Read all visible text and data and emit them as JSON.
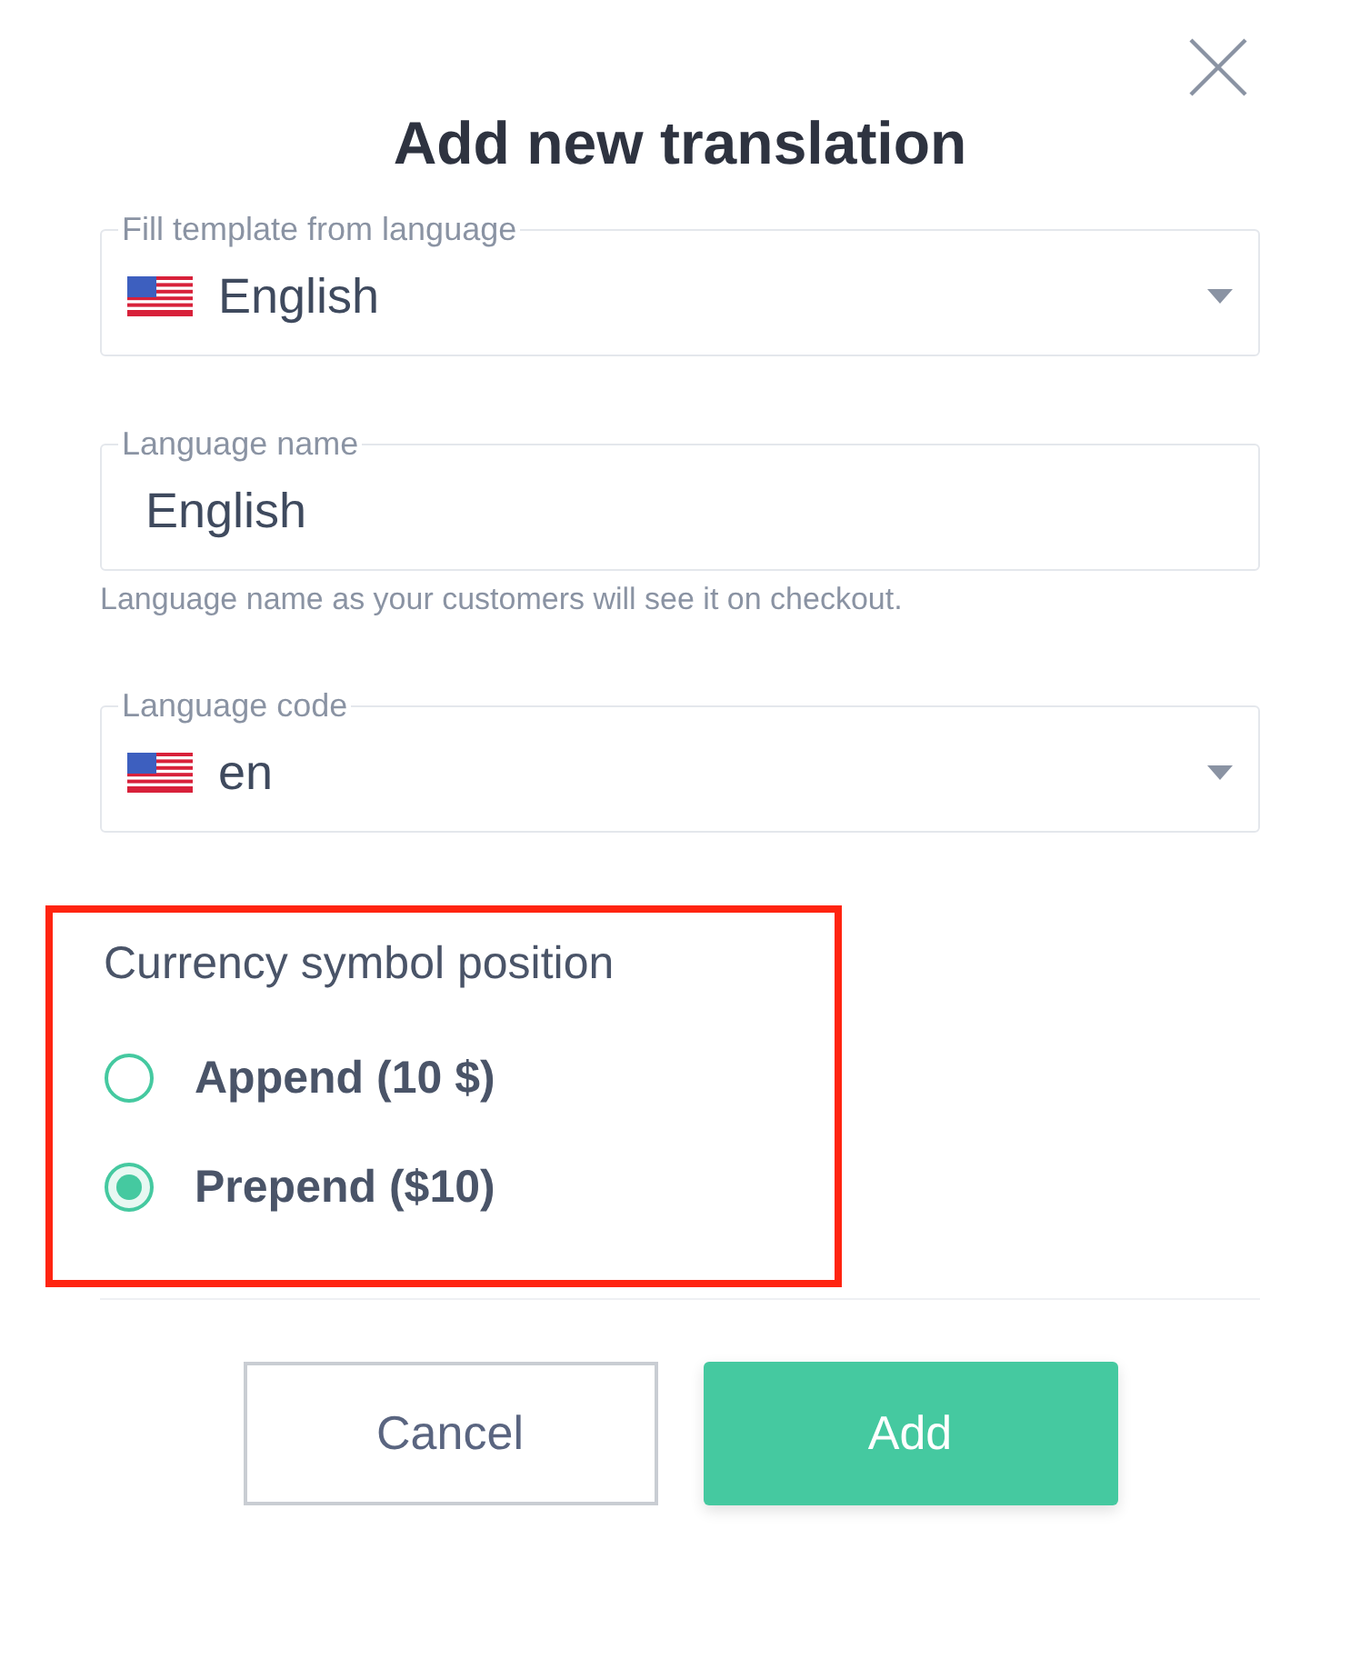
{
  "dialog": {
    "title": "Add new translation"
  },
  "fields": [
    {
      "kind": "select",
      "label": "Fill template from language",
      "value": "English",
      "flag": true
    },
    {
      "kind": "text",
      "label": "Language name",
      "value": "English",
      "flag": false,
      "helper": "Language name as your customers will see it on checkout."
    },
    {
      "kind": "select",
      "label": "Language code",
      "value": "en",
      "flag": true
    }
  ],
  "currency_position": {
    "title": "Currency symbol position",
    "highlighted": true,
    "options": [
      {
        "label": "Append (10 $)",
        "selected": false
      },
      {
        "label": "Prepend ($10)",
        "selected": true
      }
    ]
  },
  "buttons": [
    {
      "kind": "secondary",
      "label": "Cancel"
    },
    {
      "kind": "primary",
      "label": "Add"
    }
  ]
}
